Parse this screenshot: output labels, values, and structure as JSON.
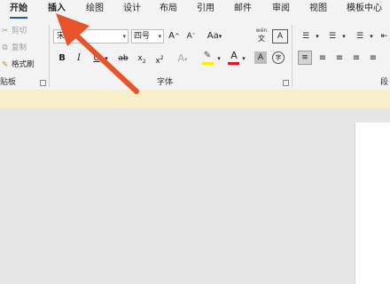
{
  "tabs": [
    "开始",
    "插入",
    "绘图",
    "设计",
    "布局",
    "引用",
    "邮件",
    "审阅",
    "视图",
    "模板中心"
  ],
  "clipboard": {
    "cut": "剪切",
    "copy": "复制",
    "format_painter": "格式刷",
    "group_label": "贴板"
  },
  "font": {
    "name": "宋",
    "size": "四号",
    "grow": "A",
    "shrink": "A",
    "case": "Aa",
    "pinyin_top": "wén",
    "pinyin_bottom": "文",
    "bold": "B",
    "italic": "I",
    "underline": "U",
    "strikethrough": "ab",
    "subscript_base": "x",
    "subscript": "2",
    "superscript_base": "x",
    "superscript": "2",
    "text_effect": "A",
    "font_color": "A",
    "char_shading": "A",
    "enclose": "字",
    "group_label": "字体"
  },
  "paragraph": {
    "group_label": "段"
  },
  "colors": {
    "accent": "#2b579a",
    "arrow": "#e8532b",
    "highlight": "#ffeb00",
    "font_color": "#e81123"
  }
}
